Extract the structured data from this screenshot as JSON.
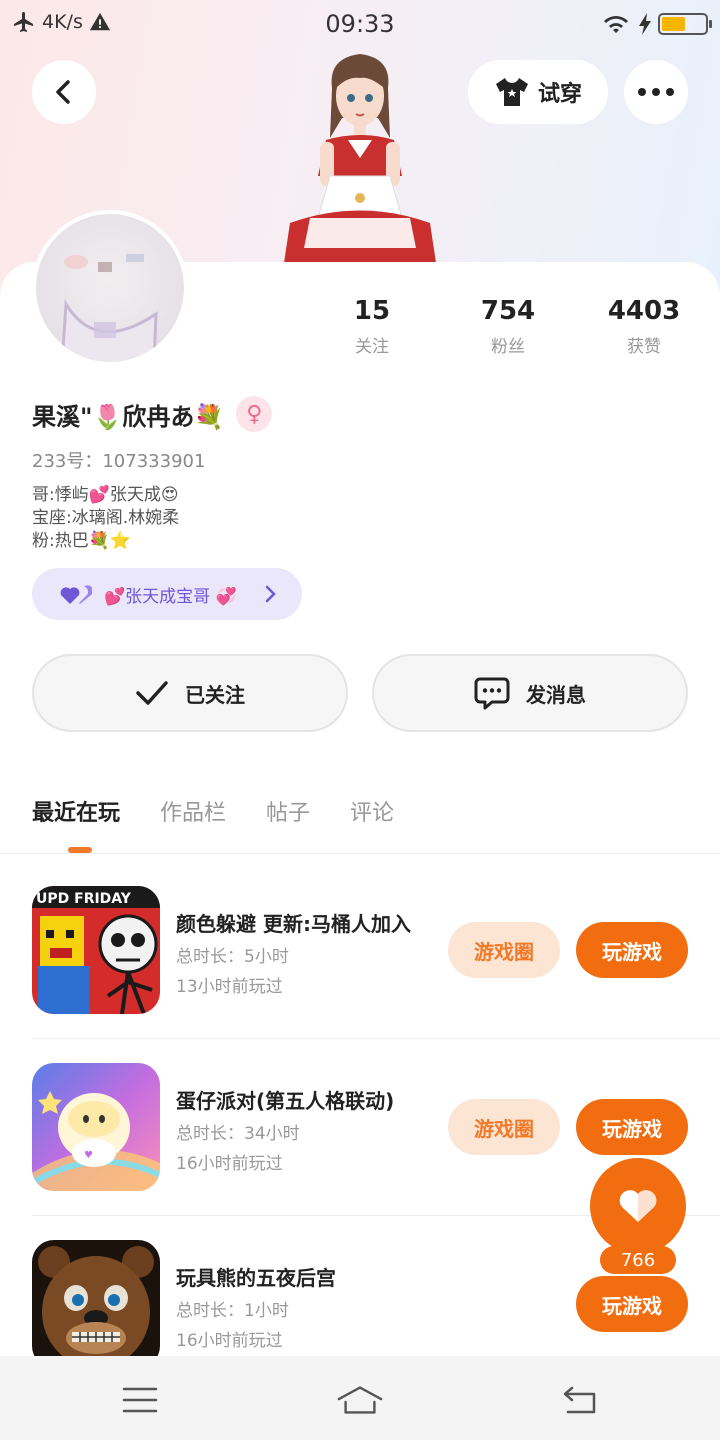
{
  "status_bar": {
    "network_speed": "4K/s",
    "time": "09:33",
    "battery_level": 0.55,
    "icons": [
      "airplane-icon",
      "warning-icon",
      "wifi-icon",
      "charging-icon",
      "battery-icon"
    ]
  },
  "header": {
    "tryon_label": "试穿"
  },
  "profile": {
    "stats": [
      {
        "value": "15",
        "label": "关注"
      },
      {
        "value": "754",
        "label": "粉丝"
      },
      {
        "value": "4403",
        "label": "获赞"
      }
    ],
    "name": "果溪\"🌷欣冉あ💐",
    "gender_symbol": "♀",
    "uid": "233号：107333901",
    "bio": [
      "哥:悸屿💕张天成😍",
      "宝座:冰璃阁.林婉柔",
      "粉:热巴💐⭐"
    ],
    "badge_text": "💕张天成宝哥 💞"
  },
  "actions": {
    "follow_label": "已关注",
    "message_label": "发消息"
  },
  "tabs": [
    "最近在玩",
    "作品栏",
    "帖子",
    "评论"
  ],
  "games": [
    {
      "title": "颜色躲避 更新:马桶人加入",
      "duration": "总时长：5小时",
      "last_played": "13小时前玩过",
      "circle_label": "游戏圈",
      "play_label": "玩游戏",
      "thumb_text": "UPD FRIDAY"
    },
    {
      "title": "蛋仔派对(第五人格联动)",
      "duration": "总时长：34小时",
      "last_played": "16小时前玩过",
      "circle_label": "游戏圈",
      "play_label": "玩游戏",
      "thumb_text": ""
    },
    {
      "title": "玩具熊的五夜后宫",
      "duration": "总时长：1小时",
      "last_played": "16小时前玩过",
      "circle_label": "",
      "play_label": "玩游戏",
      "thumb_text": ""
    }
  ],
  "like": {
    "count": "766"
  },
  "colors": {
    "accent": "#f26d0f",
    "accent_soft": "#fde5d4",
    "badge_bg": "#ebe7fb",
    "badge_text": "#6f56d6"
  }
}
